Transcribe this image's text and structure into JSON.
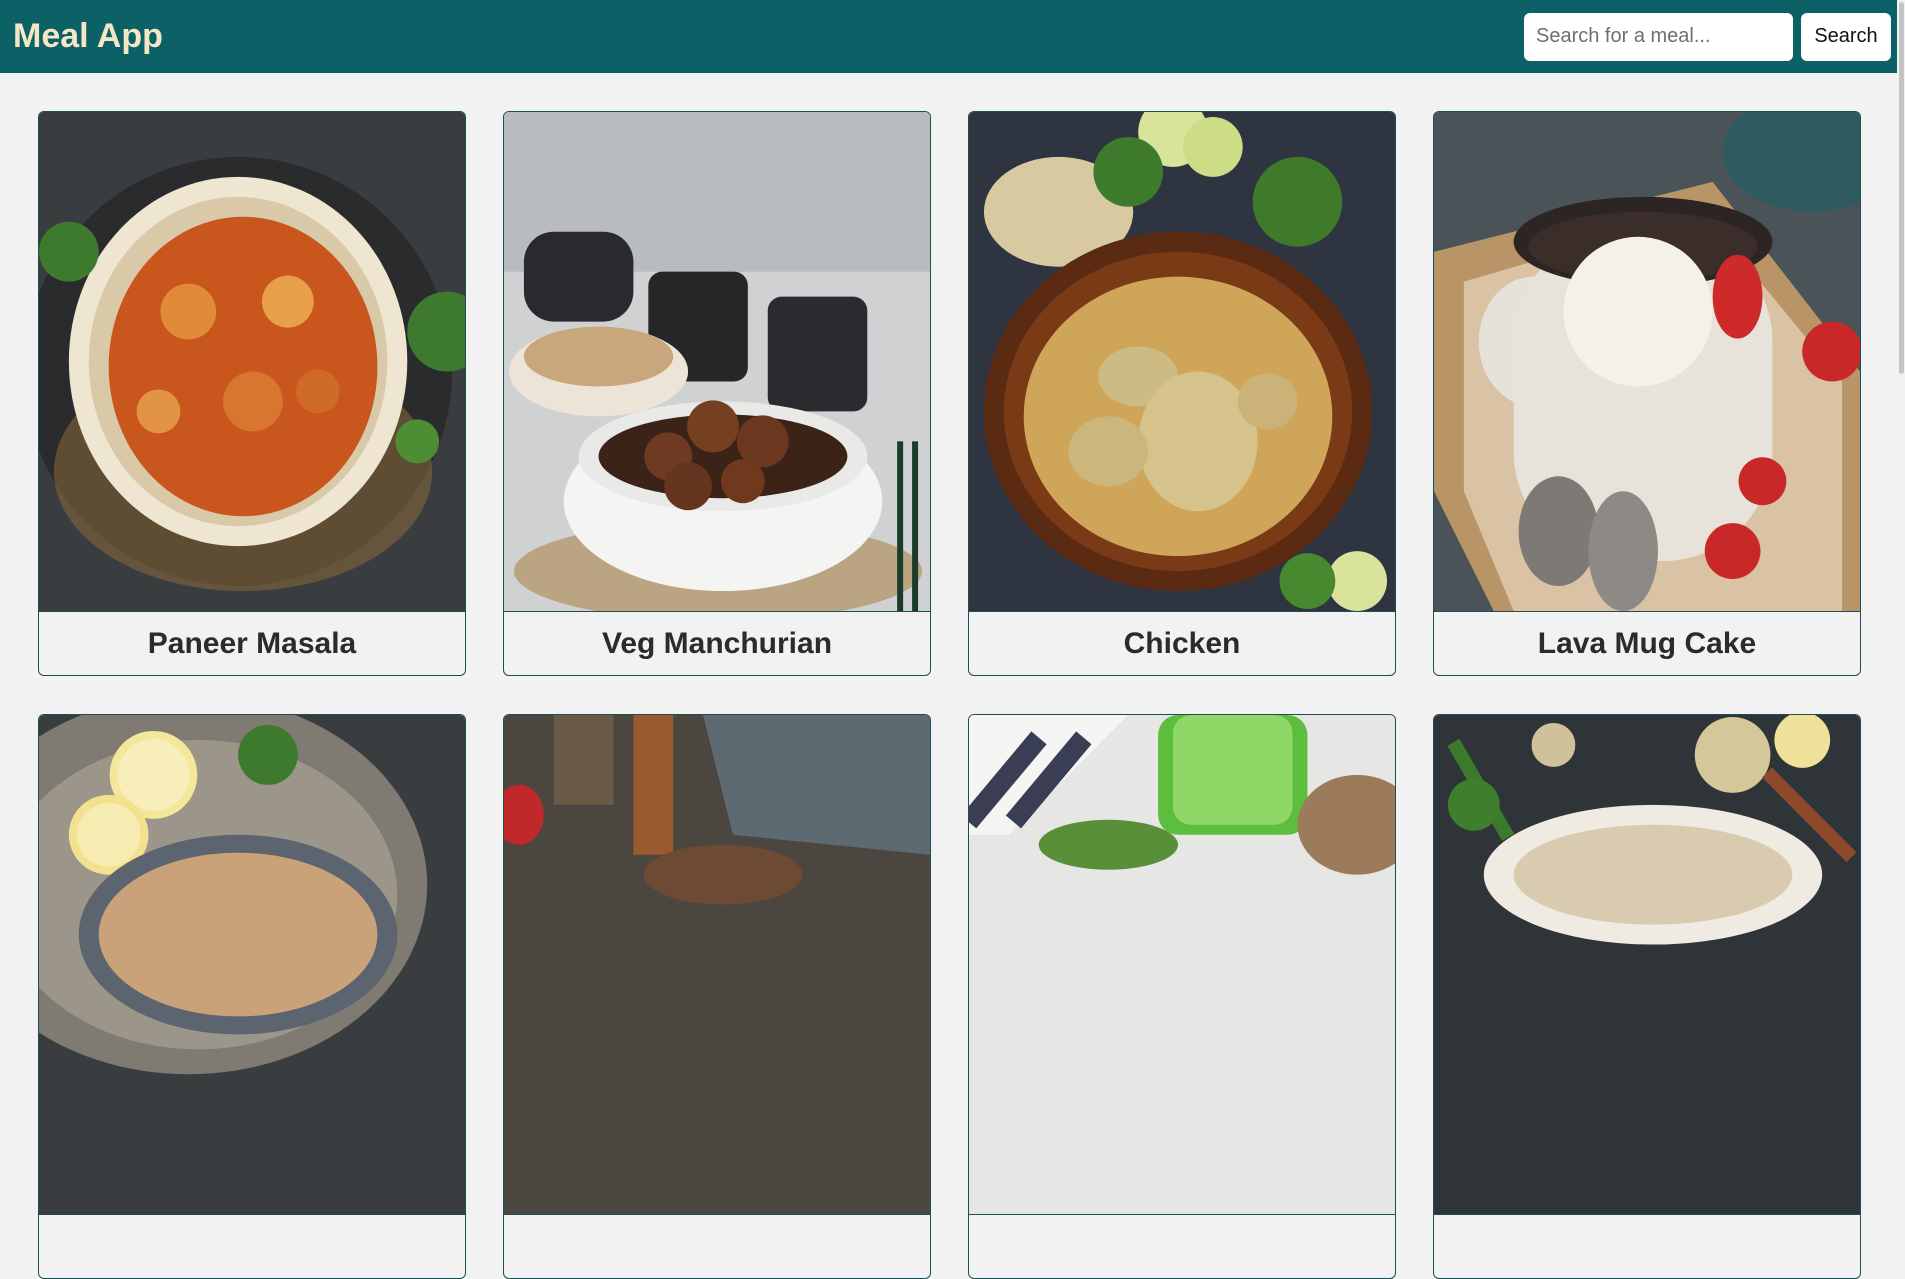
{
  "header": {
    "brand": "Meal App",
    "search": {
      "placeholder": "Search for a meal...",
      "value": ""
    },
    "search_button_label": "Search"
  },
  "meals": [
    {
      "name": "Paneer Masala"
    },
    {
      "name": "Veg Manchurian"
    },
    {
      "name": "Chicken"
    },
    {
      "name": "Lava Mug Cake"
    },
    {
      "name": ""
    },
    {
      "name": ""
    },
    {
      "name": ""
    },
    {
      "name": ""
    }
  ],
  "colors": {
    "navbar": "#0b6166",
    "brand_text": "#f5e6c8",
    "card_border": "#1e4e52",
    "page_background": "#f2f2f2"
  }
}
